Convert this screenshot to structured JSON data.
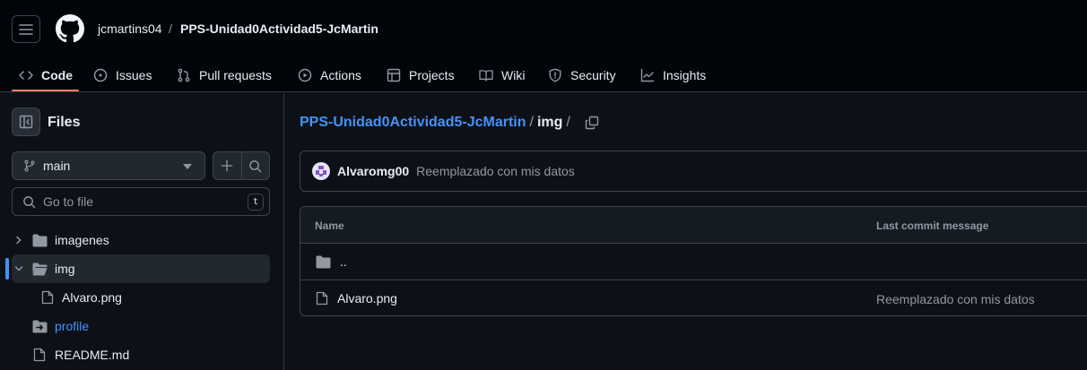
{
  "header": {
    "owner": "jcmartins04",
    "separator": "/",
    "repo": "PPS-Unidad0Actividad5-JcMartin"
  },
  "tabs": [
    {
      "label": "Code",
      "icon": "code-icon"
    },
    {
      "label": "Issues",
      "icon": "issue-opened-icon"
    },
    {
      "label": "Pull requests",
      "icon": "git-pull-request-icon"
    },
    {
      "label": "Actions",
      "icon": "play-icon"
    },
    {
      "label": "Projects",
      "icon": "table-icon"
    },
    {
      "label": "Wiki",
      "icon": "book-icon"
    },
    {
      "label": "Security",
      "icon": "shield-icon"
    },
    {
      "label": "Insights",
      "icon": "graph-icon"
    }
  ],
  "sidebar": {
    "title": "Files",
    "branch": "main",
    "goto_placeholder": "Go to file",
    "goto_shortcut": "t",
    "tree": [
      {
        "label": "imagenes",
        "type": "folder",
        "expanded": false
      },
      {
        "label": "img",
        "type": "folder",
        "expanded": true,
        "selected": true
      },
      {
        "label": "Alvaro.png",
        "type": "file"
      },
      {
        "label": "profile",
        "type": "submodule"
      },
      {
        "label": "README.md",
        "type": "file"
      }
    ]
  },
  "main": {
    "breadcrumb": {
      "repo": "PPS-Unidad0Actividad5-JcMartin",
      "sep": "/",
      "folder": "img",
      "trail": "/"
    },
    "latest_commit": {
      "author": "Alvaromg00",
      "message": "Reemplazado con mis datos"
    },
    "table": {
      "headers": {
        "name": "Name",
        "last_commit": "Last commit message"
      },
      "rows": [
        {
          "name": "..",
          "type": "parent",
          "message": ""
        },
        {
          "name": "Alvaro.png",
          "type": "file",
          "message": "Reemplazado con mis datos"
        }
      ]
    }
  },
  "colors": {
    "accent": "#4493f8",
    "underline": "#f78166",
    "bg": "#0d1117",
    "header_bg": "#010409"
  }
}
